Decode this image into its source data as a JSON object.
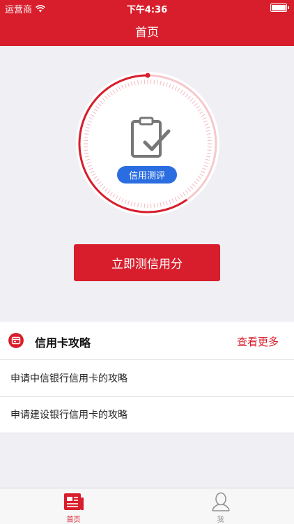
{
  "status_bar": {
    "carrier": "运营商",
    "time": "下午4:36"
  },
  "nav": {
    "title": "首页"
  },
  "hero": {
    "badge_label": "信用测评",
    "cta_label": "立即测信用分"
  },
  "guide_section": {
    "title": "信用卡攻略",
    "more_label": "查看更多",
    "articles": [
      {
        "title": "申请中信银行信用卡的攻略"
      },
      {
        "title": "申请建设银行信用卡的攻略"
      }
    ]
  },
  "tab_bar": {
    "items": [
      {
        "label": "首页",
        "icon": "news-icon",
        "active": true
      },
      {
        "label": "我",
        "icon": "user-icon",
        "active": false
      }
    ]
  },
  "colors": {
    "brand_red": "#d81e2c",
    "badge_blue": "#2a6de0",
    "background": "#efeff4"
  }
}
